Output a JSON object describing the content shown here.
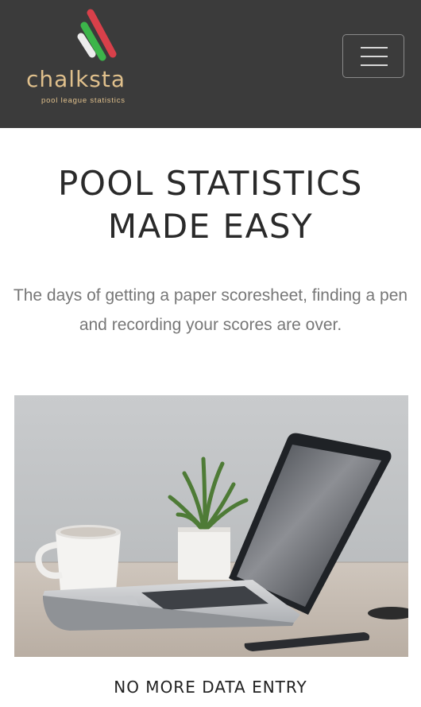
{
  "header": {
    "brand_name": "chalksta",
    "tagline": "pool league statistics",
    "logo_icon": "chalk-sticks-logo-icon",
    "menu_icon": "hamburger-menu-icon",
    "colors": {
      "navbar_bg": "#3b3b3b",
      "brand_text": "#e0c08c",
      "logo_red": "#d9404a",
      "logo_green": "#3cb54a",
      "logo_white": "#ececec"
    }
  },
  "hero": {
    "title_line1": "POOL STATISTICS",
    "title_line2": "MADE EASY",
    "subtitle": "The days of getting a paper scoresheet, finding a pen and recording your scores are over."
  },
  "image": {
    "subject": "laptop-plant-coffee-desk-image"
  },
  "section": {
    "heading": "NO MORE DATA ENTRY"
  }
}
